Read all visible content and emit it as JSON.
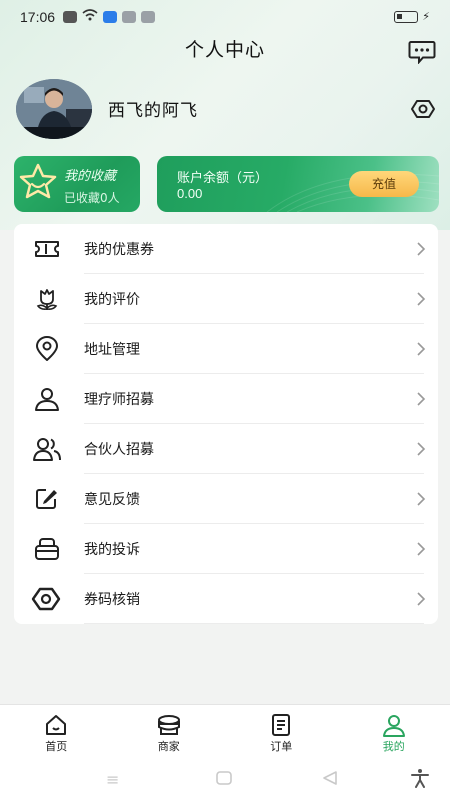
{
  "status_bar": {
    "time": "17:06"
  },
  "header": {
    "title": "个人中心"
  },
  "profile": {
    "username": "西飞的阿飞"
  },
  "favorites_card": {
    "title": "我的收藏",
    "count_text": "已收藏0人"
  },
  "balance_card": {
    "label": "账户余额（元）",
    "value": "0.00",
    "recharge_label": "充值"
  },
  "menu": {
    "items": [
      {
        "label": "我的优惠券",
        "icon": "coupon-icon"
      },
      {
        "label": "我的评价",
        "icon": "review-flower-icon"
      },
      {
        "label": "地址管理",
        "icon": "location-pin-icon"
      },
      {
        "label": "理疗师招募",
        "icon": "person-icon"
      },
      {
        "label": "合伙人招募",
        "icon": "people-icon"
      },
      {
        "label": "意见反馈",
        "icon": "edit-icon"
      },
      {
        "label": "我的投诉",
        "icon": "complaint-icon"
      },
      {
        "label": "券码核销",
        "icon": "hexagon-icon"
      }
    ]
  },
  "bottom_nav": {
    "items": [
      {
        "label": "首页",
        "icon": "home-icon"
      },
      {
        "label": "商家",
        "icon": "merchant-icon"
      },
      {
        "label": "订单",
        "icon": "order-icon"
      },
      {
        "label": "我的",
        "icon": "user-icon",
        "active": true
      }
    ]
  },
  "colors": {
    "accent": "#2aa55f",
    "recharge": "#f6b84a"
  }
}
